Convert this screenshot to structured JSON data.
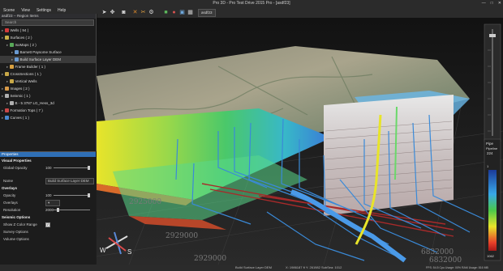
{
  "window": {
    "title": "Pro 3D - Pro Test Drive 2015 Pro - [asdf23]",
    "buttons": [
      "—",
      "□",
      "✕"
    ]
  },
  "menu": [
    "Scene",
    "View",
    "Settings",
    "Help"
  ],
  "toolbar": {
    "scene_tab": "asdf23"
  },
  "region_panel": {
    "title": "asdf23 -- Region Items",
    "search_placeholder": "Search",
    "items": [
      {
        "label": "Wells ( 94 )",
        "icon_color": "#d23a3a"
      },
      {
        "label": "Surfaces ( 2 )",
        "icon_color": "#c8b048"
      },
      {
        "label": "IsoMaps ( 2 )",
        "icon_color": "#58a858"
      },
      {
        "label": "Barnett Paysome Surface",
        "icon_color": "#6a9ad0"
      },
      {
        "label": "Build Surface Layer DEM",
        "icon_color": "#6a9ad0"
      },
      {
        "label": "Frame Builder ( 1 )",
        "icon_color": "#d8a040"
      },
      {
        "label": "CrossSections ( 1 )",
        "icon_color": "#c8a848"
      },
      {
        "label": "Vertical Wells",
        "icon_color": "#c8a848"
      },
      {
        "label": "Images ( 2 )",
        "icon_color": "#d89a48"
      },
      {
        "label": "Seismic ( 1 )",
        "icon_color": "#b0b0b0"
      },
      {
        "label": "B - 5 3787 LG_Hess_3d",
        "icon_color": "#b0b0b0"
      },
      {
        "label": "Formation Tops ( 7 )",
        "icon_color": "#c84848"
      },
      {
        "label": "Curves ( 1 )",
        "icon_color": "#4a8ad0"
      }
    ]
  },
  "properties": {
    "title": "Properties",
    "visual_properties": "Visual Properties",
    "global_opacity_label": "Global Opacity",
    "global_opacity_value": "100",
    "name_label": "Name",
    "name_value": "Build Surface Layer DEM",
    "overlays": "Overlays",
    "opacity_label": "Opacity",
    "opacity_value": "100",
    "overlays_label": "Overlays",
    "resolution_label": "Resolution",
    "resolution_value": "2000",
    "seismic_options": "Seismic Options",
    "show_z_color_range": "Show Z Color Range",
    "survey_options": "Survey Options",
    "volume_options": "Volume Options"
  },
  "viewport": {
    "axis_labels": [
      "2925000",
      "2929000",
      "2929000",
      "6832000",
      "6832000"
    ],
    "compass": {
      "w": "W",
      "s": "S"
    },
    "legend": {
      "title": "Pipe",
      "subtitle": "Pipeline",
      "value": "224",
      "top_value": "1",
      "bottom_value": "1062"
    }
  },
  "status": {
    "layer": "Build Surface Layer DEM",
    "coords": "X: 1986187 ft  Y: 261982 SubSea: 1012",
    "perf": "FPS: 54.5  Cpu Usage: 00%  RAM Usage: 816 MB"
  },
  "colors": {
    "accent": "#2f6fb5",
    "titlebar": "#2b2b2b",
    "panel": "#1c1c1c"
  }
}
